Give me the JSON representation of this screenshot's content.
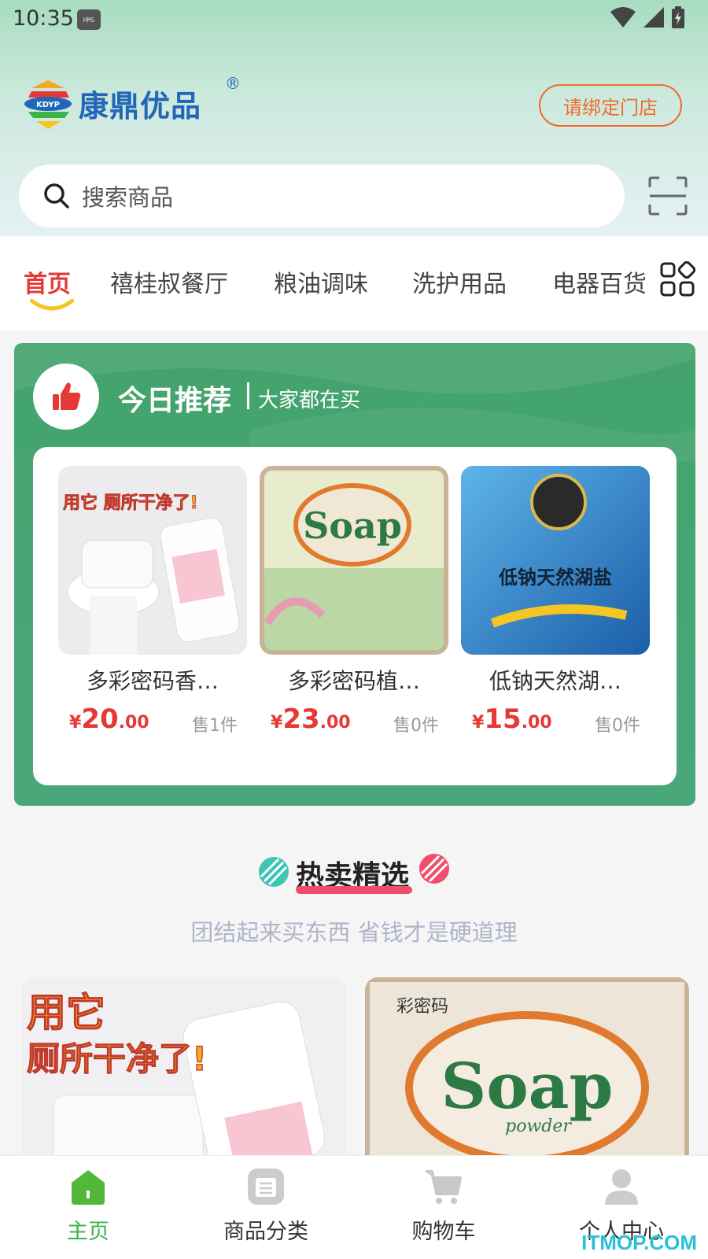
{
  "status_bar": {
    "time": "10:35",
    "hms_badge": "HMS"
  },
  "brand": {
    "name": "康鼎优品",
    "registered_mark": "®",
    "logo_letters": "KDYP"
  },
  "header": {
    "bind_store_label": "请绑定门店"
  },
  "search": {
    "placeholder": "搜索商品",
    "icon": "search-icon",
    "scan_icon": "scan-icon"
  },
  "nav_tabs": [
    {
      "label": "首页",
      "active": true
    },
    {
      "label": "禧桂叔餐厅",
      "active": false
    },
    {
      "label": "粮油调味",
      "active": false
    },
    {
      "label": "洗护用品",
      "active": false
    },
    {
      "label": "电器百货",
      "active": false
    }
  ],
  "recommend": {
    "title": "今日推荐",
    "subtitle": "大家都在买",
    "products": [
      {
        "name": "多彩密码香…",
        "price_currency": "¥",
        "price_int": "20",
        "price_dec": ".00",
        "sold": "售1件",
        "image_caption": "用它 厕所干净了!"
      },
      {
        "name": "多彩密码植…",
        "price_currency": "¥",
        "price_int": "23",
        "price_dec": ".00",
        "sold": "售0件",
        "image_caption": "Soap"
      },
      {
        "name": "低钠天然湖…",
        "price_currency": "¥",
        "price_int": "15",
        "price_dec": ".00",
        "sold": "售0件",
        "image_caption": "低钠天然湖盐"
      }
    ]
  },
  "hot_sale": {
    "title": "热卖精选",
    "subtitle": "团结起来买东西 省钱才是硬道理",
    "cards": [
      {
        "caption_line1": "用它",
        "caption_line2": "厕所干净了!"
      },
      {
        "brand": "彩密码",
        "caption": "Soap",
        "caption_sub": "powder"
      }
    ]
  },
  "bottom_nav": [
    {
      "label": "主页",
      "icon": "home-icon",
      "active": true
    },
    {
      "label": "商品分类",
      "icon": "category-icon",
      "active": false
    },
    {
      "label": "购物车",
      "icon": "cart-icon",
      "active": false
    },
    {
      "label": "个人中心",
      "icon": "user-icon",
      "active": false
    }
  ],
  "watermark": "ITMOP.COM",
  "colors": {
    "accent_red": "#e53935",
    "brand_blue": "#2266b8",
    "green": "#43a36c",
    "orange": "#f06a2a",
    "active_green": "#3bb34a"
  }
}
